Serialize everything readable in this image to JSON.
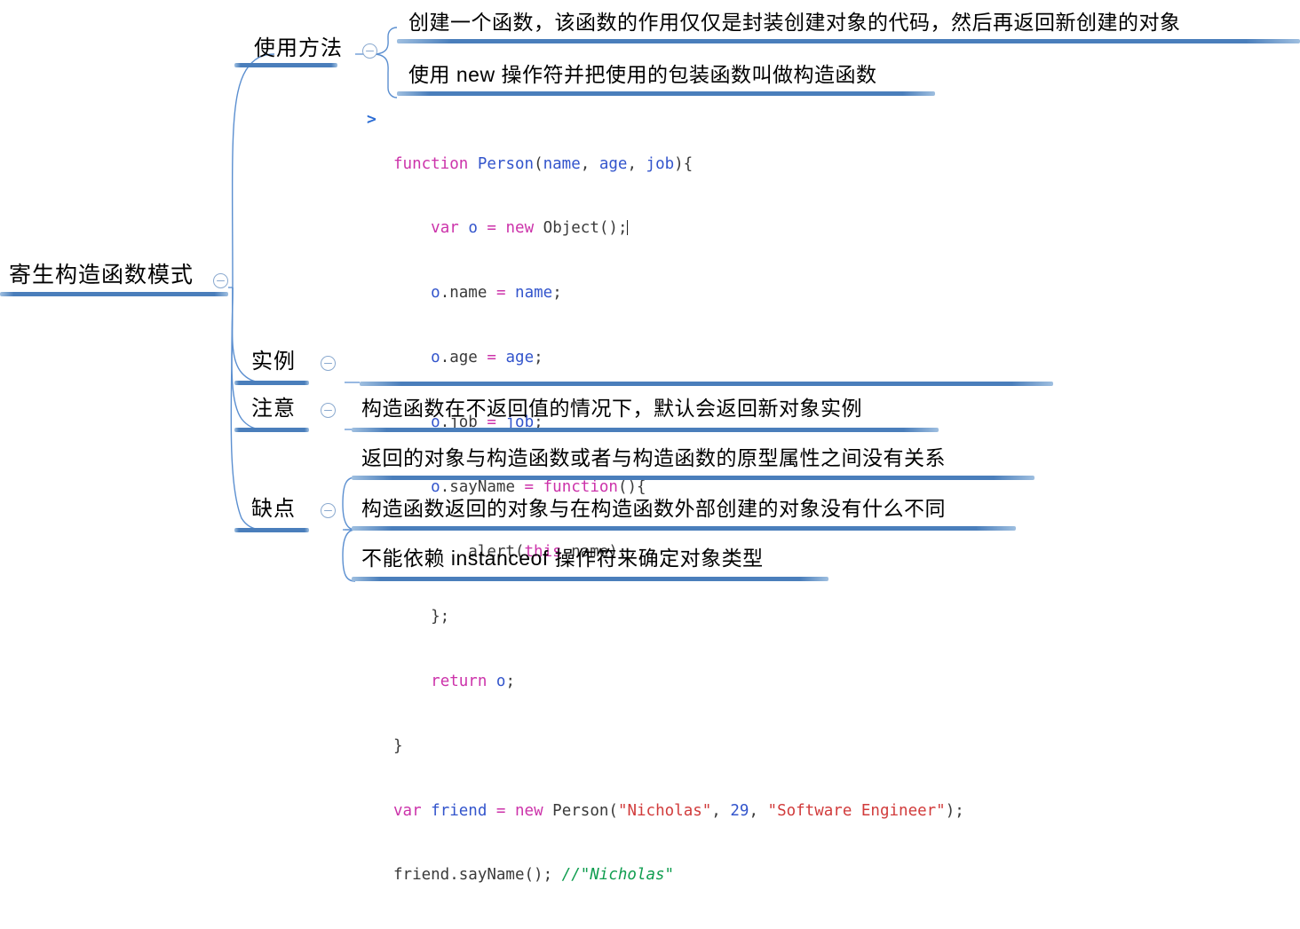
{
  "mindmap": {
    "root": {
      "label": "寄生构造函数模式",
      "toggle_icon": "collapse-minus-icon"
    },
    "branches": [
      {
        "id": "usage",
        "label": "使用方法",
        "toggle_icon": "collapse-minus-icon",
        "children": [
          {
            "id": "usage-1",
            "label": "创建一个函数，该函数的作用仅仅是封装创建对象的代码，然后再返回新创建的对象"
          },
          {
            "id": "usage-2",
            "label": "使用 new 操作符并把使用的包装函数叫做构造函数"
          }
        ]
      },
      {
        "id": "example",
        "label": "实例",
        "toggle_icon": "collapse-minus-icon",
        "children": []
      },
      {
        "id": "note",
        "label": "注意",
        "toggle_icon": "collapse-minus-icon",
        "children": [
          {
            "id": "note-1",
            "label": "构造函数在不返回值的情况下，默认会返回新对象实例"
          }
        ]
      },
      {
        "id": "drawback",
        "label": "缺点",
        "toggle_icon": "collapse-minus-icon",
        "children": [
          {
            "id": "drawback-1",
            "label": "返回的对象与构造函数或者与构造函数的原型属性之间没有关系"
          },
          {
            "id": "drawback-2",
            "label": "构造函数返回的对象与在构造函数外部创建的对象没有什么不同"
          },
          {
            "id": "drawback-3",
            "label": "不能依赖 instanceof 操作符来确定对象类型"
          }
        ]
      }
    ]
  },
  "code_block": {
    "marker_icon": "chevron-right-icon",
    "language": "javascript",
    "lines": [
      "function Person(name, age, job){",
      "    var o = new Object();",
      "    o.name = name;",
      "    o.age = age;",
      "    o.job = job;",
      "    o.sayName = function(){",
      "        alert(this.name);",
      "    };",
      "    return o;",
      "}",
      "var friend = new Person(\"Nicholas\", 29, \"Software Engineer\");",
      "friend.sayName(); //\"Nicholas\""
    ]
  },
  "colors": {
    "bar": "#4a7ebb",
    "connector": "#5b8fd0",
    "toggle_border": "#8aa9cf",
    "keyword": "#cc33aa",
    "identifier": "#3355cc",
    "string": "#d13b3b",
    "number": "#3355cc",
    "comment": "#0f9d4f",
    "text": "#000000"
  }
}
